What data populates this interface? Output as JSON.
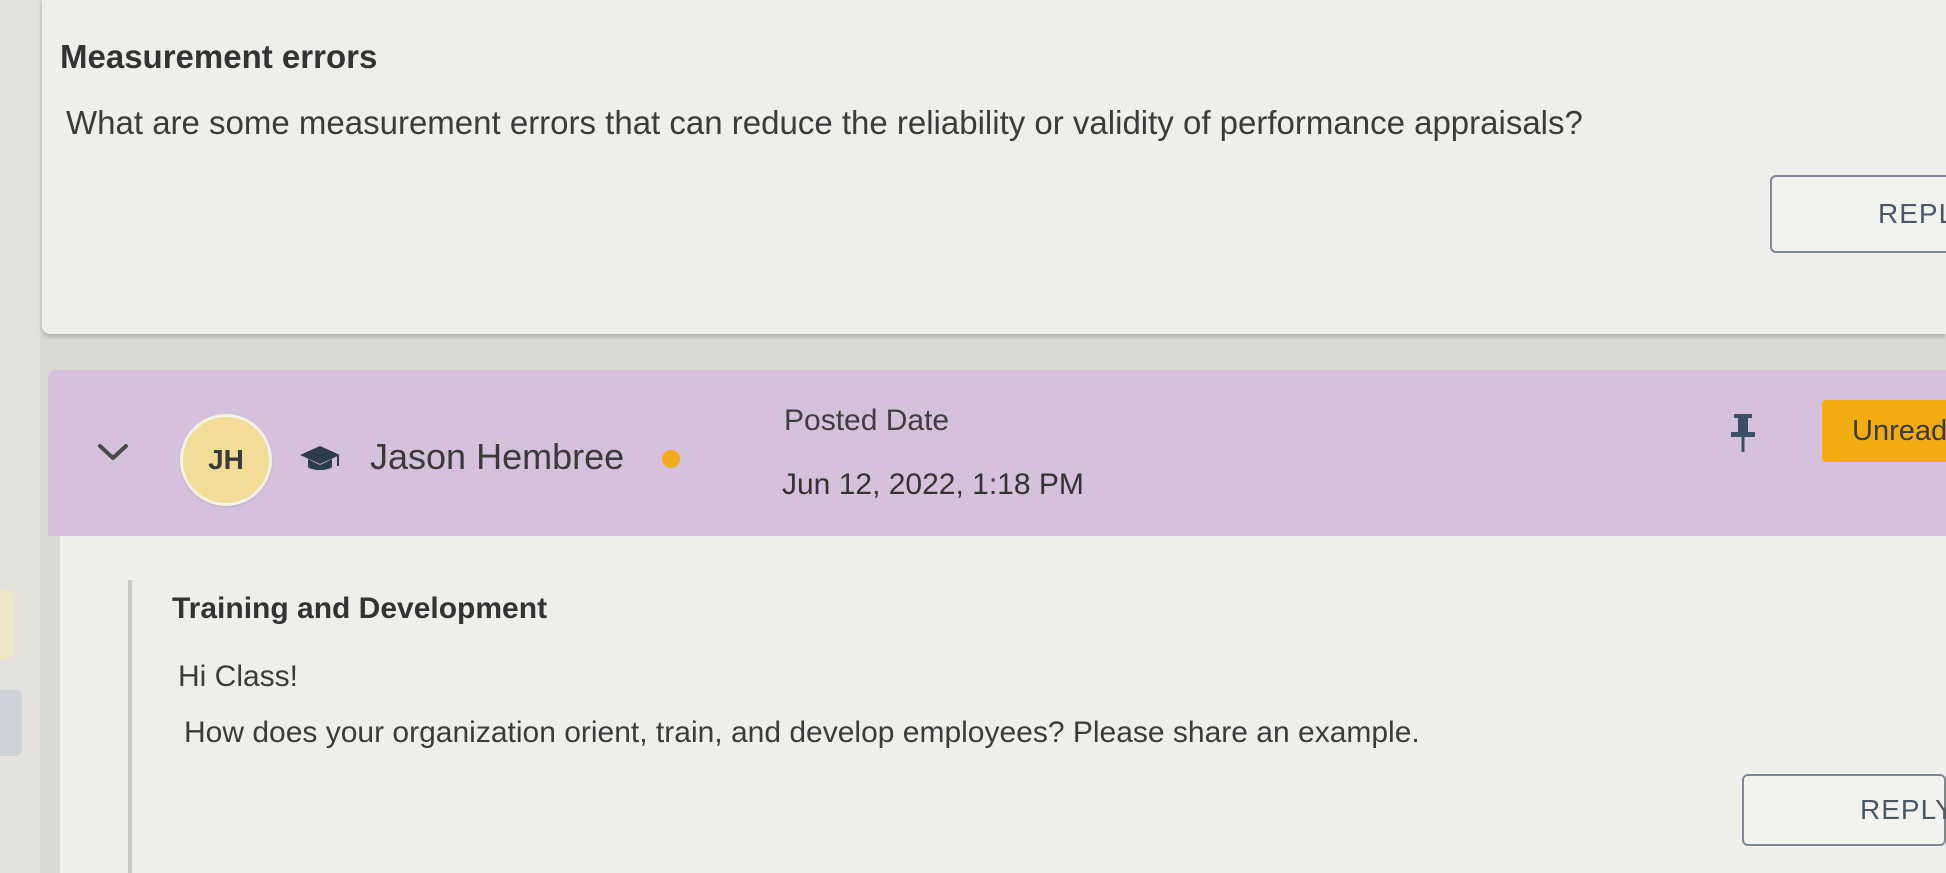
{
  "topic": {
    "title": "Measurement errors",
    "question": "What are some measurement errors that can reduce the reliability or validity of performance appraisals?",
    "reply_label": "REPLY"
  },
  "post": {
    "avatar_initials": "JH",
    "author_name": "Jason Hembree",
    "posted_label": "Posted Date",
    "posted_value": "Jun 12, 2022, 1:18 PM",
    "unread_label": "Unread",
    "title": "Training and Development",
    "greeting": "Hi Class!",
    "question": "How does your organization orient, train, and develop employees? Please share an example.",
    "reply_label": "REPLY"
  },
  "colors": {
    "header_band": "#d5c1dc",
    "avatar_bg": "#f1dc98",
    "online_dot": "#f0ab1e",
    "unread_badge": "#f3ac10",
    "reply_text": "#4a5868"
  },
  "icons": {
    "reply": "reply-arrow-icon",
    "expand": "chevron-down-icon",
    "role": "graduation-cap-icon",
    "pin": "pin-icon"
  }
}
